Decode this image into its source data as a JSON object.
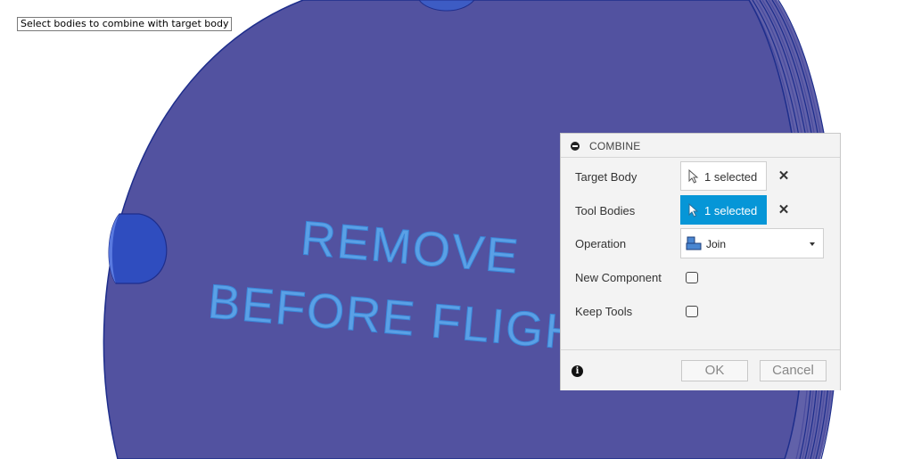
{
  "tooltip": {
    "text": "Select bodies to combine with target body"
  },
  "viewport": {
    "part_text_line1": "REMOVE",
    "part_text_line2": "BEFORE FLIGHT",
    "colors": {
      "body_fill": "#5252a0",
      "body_edge": "#1e2e8c",
      "text_fill": "#5aa0e6",
      "text_edge": "#3a86d8"
    }
  },
  "dialog": {
    "title": "COMBINE",
    "collapse_icon": "minus-circle-icon",
    "rows": {
      "target_body": {
        "label": "Target Body",
        "value": "1 selected",
        "active": false
      },
      "tool_bodies": {
        "label": "Tool Bodies",
        "value": "1 selected",
        "active": true
      },
      "operation": {
        "label": "Operation",
        "value": "Join",
        "icon": "join-icon"
      },
      "new_component": {
        "label": "New Component",
        "checked": false
      },
      "keep_tools": {
        "label": "Keep Tools",
        "checked": false
      }
    },
    "clear_symbol": "✕",
    "info_symbol": "i",
    "buttons": {
      "ok": "OK",
      "cancel": "Cancel"
    },
    "colors": {
      "active_select": "#0696d7"
    }
  }
}
